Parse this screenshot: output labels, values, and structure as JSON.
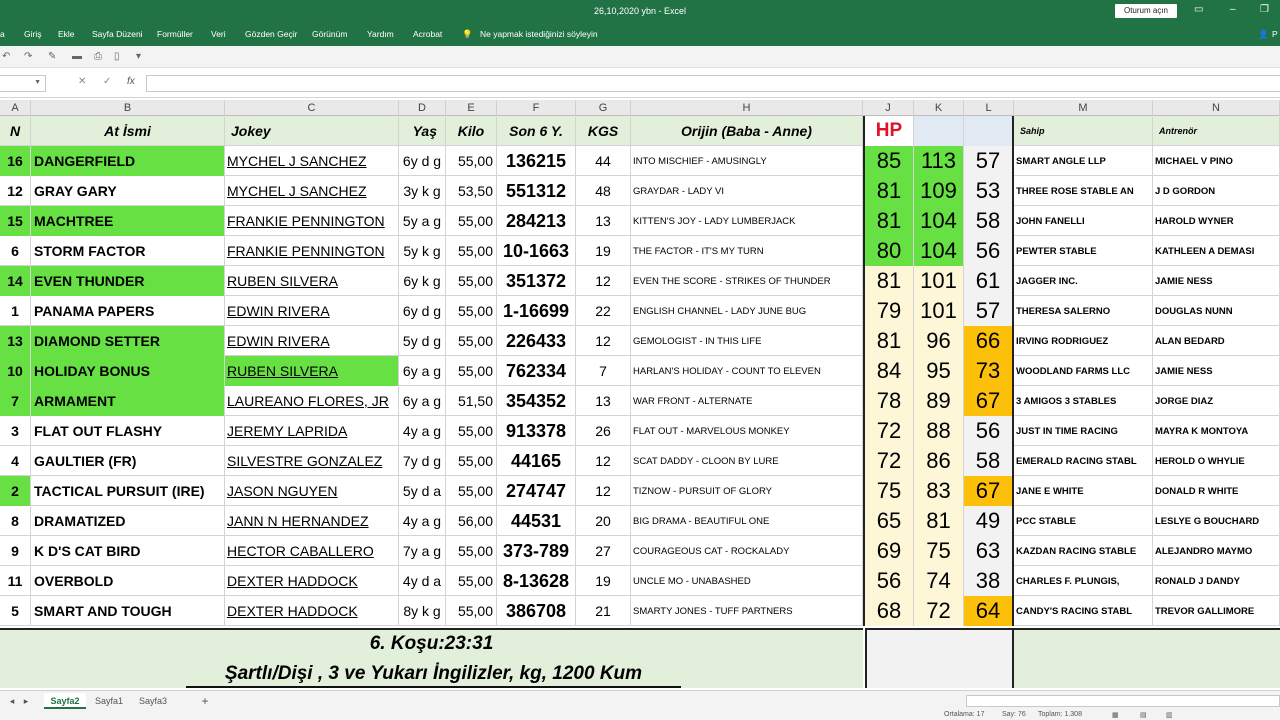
{
  "title": "26,10,2020 ybn  -  Excel",
  "signin": "Oturum açın",
  "menu": [
    "a",
    "Giriş",
    "Ekle",
    "Sayfa Düzeni",
    "Formüller",
    "Veri",
    "Gözden Geçir",
    "Görünüm",
    "Yardım",
    "Acrobat"
  ],
  "tellme": "Ne yapmak istediğinizi söyleyin",
  "share": "P",
  "formula_fx": "fx",
  "column_letters": [
    "A",
    "B",
    "C",
    "D",
    "E",
    "F",
    "G",
    "H",
    "J",
    "K",
    "L",
    "M",
    "N"
  ],
  "headers": {
    "no": "N",
    "horse": "At İsmi",
    "jockey": "Jokey",
    "age": "Yaş",
    "kilo": "Kilo",
    "son6": "Son 6 Y.",
    "kgs": "KGS",
    "origin": "Orijin (Baba - Anne)",
    "hp": "HP",
    "k": "",
    "l": "",
    "owner": "Sahip",
    "trainer": "Antrenör"
  },
  "rows": [
    {
      "no": "16",
      "horse": "DANGERFIELD",
      "jockey": "MYCHEL J SANCHEZ",
      "age": "6y d g",
      "kilo": "55,00",
      "son6": "136215",
      "kgs": "44",
      "origin": "INTO MISCHIEF - AMUSINGLY",
      "hp": "85",
      "k": "113",
      "l": "57",
      "owner": "SMART ANGLE LLP",
      "trainer": "MICHAEL V PINO",
      "green": true,
      "jgreen": false,
      "hpc": "green",
      "kc": "green",
      "lc": "grey"
    },
    {
      "no": "12",
      "horse": "GRAY GARY",
      "jockey": "MYCHEL J SANCHEZ",
      "age": "3y k g",
      "kilo": "53,50",
      "son6": "551312",
      "kgs": "48",
      "origin": "GRAYDAR - LADY VI",
      "hp": "81",
      "k": "109",
      "l": "53",
      "owner": "THREE ROSE STABLE AN",
      "trainer": "J D GORDON",
      "green": false,
      "jgreen": false,
      "hpc": "green",
      "kc": "green",
      "lc": "grey"
    },
    {
      "no": "15",
      "horse": "MACHTREE",
      "jockey": "FRANKIE PENNINGTON",
      "age": "5y a g",
      "kilo": "55,00",
      "son6": "284213",
      "kgs": "13",
      "origin": "KITTEN'S JOY - LADY LUMBERJACK",
      "hp": "81",
      "k": "104",
      "l": "58",
      "owner": "JOHN FANELLI",
      "trainer": "HAROLD WYNER",
      "green": true,
      "jgreen": false,
      "hpc": "green",
      "kc": "green",
      "lc": "grey"
    },
    {
      "no": "6",
      "horse": "STORM FACTOR",
      "jockey": "FRANKIE PENNINGTON",
      "age": "5y k g",
      "kilo": "55,00",
      "son6": "10-1663",
      "kgs": "19",
      "origin": "THE FACTOR - IT'S MY TURN",
      "hp": "80",
      "k": "104",
      "l": "56",
      "owner": "PEWTER STABLE",
      "trainer": "KATHLEEN A DEMASI",
      "green": false,
      "jgreen": false,
      "hpc": "green",
      "kc": "green",
      "lc": "grey"
    },
    {
      "no": "14",
      "horse": "EVEN THUNDER",
      "jockey": "RUBEN SILVERA",
      "age": "6y k g",
      "kilo": "55,00",
      "son6": "351372",
      "kgs": "12",
      "origin": "EVEN THE SCORE - STRIKES OF THUNDER",
      "hp": "81",
      "k": "101",
      "l": "61",
      "owner": "JAGGER INC.",
      "trainer": "JAMIE NESS",
      "green": true,
      "jgreen": false,
      "hpc": "cream",
      "kc": "cream",
      "lc": "grey"
    },
    {
      "no": "1",
      "horse": "PANAMA PAPERS",
      "jockey": "EDWIN RIVERA",
      "age": "6y d g",
      "kilo": "55,00",
      "son6": "1-16699",
      "kgs": "22",
      "origin": "ENGLISH CHANNEL - LADY JUNE BUG",
      "hp": "79",
      "k": "101",
      "l": "57",
      "owner": "THERESA SALERNO",
      "trainer": "DOUGLAS NUNN",
      "green": false,
      "jgreen": false,
      "hpc": "cream",
      "kc": "cream",
      "lc": "grey"
    },
    {
      "no": "13",
      "horse": "DIAMOND SETTER",
      "jockey": "EDWIN RIVERA",
      "age": "5y d g",
      "kilo": "55,00",
      "son6": "226433",
      "kgs": "12",
      "origin": "GEMOLOGIST - IN THIS LIFE",
      "hp": "81",
      "k": "96",
      "l": "66",
      "owner": "IRVING RODRIGUEZ",
      "trainer": "ALAN BEDARD",
      "green": true,
      "jgreen": false,
      "hpc": "cream",
      "kc": "cream",
      "lc": "orange"
    },
    {
      "no": "10",
      "horse": "HOLIDAY BONUS",
      "jockey": "RUBEN SILVERA",
      "age": "6y a g",
      "kilo": "55,00",
      "son6": "762334",
      "kgs": "7",
      "origin": "HARLAN'S HOLIDAY - COUNT TO ELEVEN",
      "hp": "84",
      "k": "95",
      "l": "73",
      "owner": "WOODLAND FARMS LLC",
      "trainer": "JAMIE NESS",
      "green": true,
      "jgreen": true,
      "hpc": "cream",
      "kc": "cream",
      "lc": "orange"
    },
    {
      "no": "7",
      "horse": "ARMAMENT",
      "jockey": "LAUREANO FLORES, JR",
      "age": "6y a g",
      "kilo": "51,50",
      "son6": "354352",
      "kgs": "13",
      "origin": "WAR FRONT - ALTERNATE",
      "hp": "78",
      "k": "89",
      "l": "67",
      "owner": "3 AMIGOS 3 STABLES",
      "trainer": "JORGE DIAZ",
      "green": true,
      "jgreen": false,
      "hpc": "cream",
      "kc": "cream",
      "lc": "orange"
    },
    {
      "no": "3",
      "horse": "FLAT OUT FLASHY",
      "jockey": "JEREMY LAPRIDA",
      "age": "4y a g",
      "kilo": "55,00",
      "son6": "913378",
      "kgs": "26",
      "origin": "FLAT OUT - MARVELOUS MONKEY",
      "hp": "72",
      "k": "88",
      "l": "56",
      "owner": "JUST IN TIME RACING",
      "trainer": "MAYRA K MONTOYA",
      "green": false,
      "jgreen": false,
      "hpc": "cream",
      "kc": "cream",
      "lc": "grey"
    },
    {
      "no": "4",
      "horse": "GAULTIER (FR)",
      "jockey": "SILVESTRE GONZALEZ",
      "age": "7y d g",
      "kilo": "55,00",
      "son6": "44165",
      "kgs": "12",
      "origin": "SCAT DADDY - CLOON BY LURE",
      "hp": "72",
      "k": "86",
      "l": "58",
      "owner": "EMERALD RACING STABL",
      "trainer": "HEROLD O WHYLIE",
      "green": false,
      "jgreen": false,
      "hpc": "cream",
      "kc": "cream",
      "lc": "grey"
    },
    {
      "no": "2",
      "horse": "TACTICAL PURSUIT (IRE)",
      "jockey": "JASON NGUYEN",
      "age": "5y d a",
      "kilo": "55,00",
      "son6": "274747",
      "kgs": "12",
      "origin": "TIZNOW - PURSUIT OF GLORY",
      "hp": "75",
      "k": "83",
      "l": "67",
      "owner": "JANE E WHITE",
      "trainer": "DONALD R WHITE",
      "green": false,
      "nogreen": true,
      "jgreen": false,
      "hpc": "cream",
      "kc": "cream",
      "lc": "orange"
    },
    {
      "no": "8",
      "horse": "DRAMATIZED",
      "jockey": "JANN N HERNANDEZ",
      "age": "4y a g",
      "kilo": "56,00",
      "son6": "44531",
      "kgs": "20",
      "origin": "BIG DRAMA - BEAUTIFUL ONE",
      "hp": "65",
      "k": "81",
      "l": "49",
      "owner": "PCC STABLE",
      "trainer": "LESLYE G BOUCHARD",
      "green": false,
      "jgreen": false,
      "hpc": "cream",
      "kc": "cream",
      "lc": "grey"
    },
    {
      "no": "9",
      "horse": "K D'S CAT BIRD",
      "jockey": "HECTOR CABALLERO",
      "age": "7y a g",
      "kilo": "55,00",
      "son6": "373-789",
      "kgs": "27",
      "origin": "COURAGEOUS CAT - ROCKALADY",
      "hp": "69",
      "k": "75",
      "l": "63",
      "owner": "KAZDAN RACING STABLE",
      "trainer": "ALEJANDRO MAYMO",
      "green": false,
      "jgreen": false,
      "hpc": "cream",
      "kc": "cream",
      "lc": "grey"
    },
    {
      "no": "11",
      "horse": "OVERBOLD",
      "jockey": "DEXTER HADDOCK",
      "age": "4y d a",
      "kilo": "55,00",
      "son6": "8-13628",
      "kgs": "19",
      "origin": "UNCLE MO - UNABASHED",
      "hp": "56",
      "k": "74",
      "l": "38",
      "owner": "CHARLES F. PLUNGIS,",
      "trainer": "RONALD J DANDY",
      "green": false,
      "jgreen": false,
      "hpc": "cream",
      "kc": "cream",
      "lc": "grey"
    },
    {
      "no": "5",
      "horse": "SMART AND TOUGH",
      "jockey": "DEXTER HADDOCK",
      "age": "8y k g",
      "kilo": "55,00",
      "son6": "386708",
      "kgs": "21",
      "origin": "SMARTY JONES - TUFF PARTNERS",
      "hp": "68",
      "k": "72",
      "l": "64",
      "owner": "CANDY'S RACING STABL",
      "trainer": "TREVOR GALLIMORE",
      "green": false,
      "jgreen": false,
      "hpc": "cream",
      "kc": "cream",
      "lc": "orange"
    }
  ],
  "race_title": "6. Koşu:23:31",
  "race_desc": "Şartlı/Dişi , 3 ve Yukarı İngilizler, kg, 1200 Kum",
  "sheets": [
    "Sayfa2",
    "Sayfa1",
    "Sayfa3"
  ],
  "add_sheet": "+",
  "status": {
    "avg": "Ortalama: 17",
    "count": "Say: 76",
    "sum": "Toplam: 1.308"
  },
  "colors": {
    "excel_green": "#217346",
    "cell_green": "#66e043",
    "orange": "#fcbf0a",
    "cream": "#fdf6d7",
    "header_bg": "#e2efda"
  }
}
